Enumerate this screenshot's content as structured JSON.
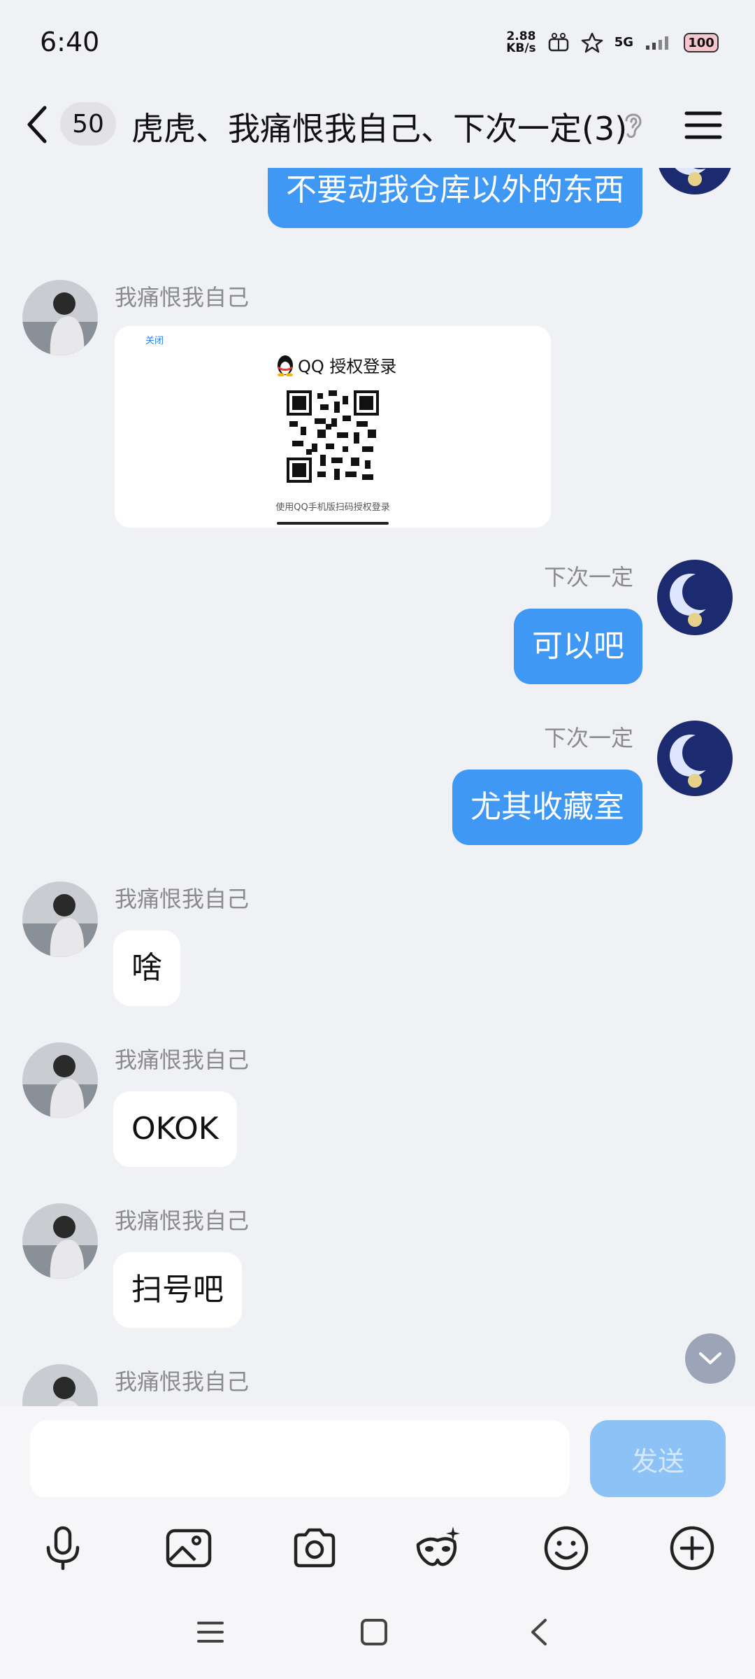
{
  "status_bar": {
    "time": "6:40",
    "speed_value": "2.88",
    "speed_unit": "KB/s",
    "network": "5G",
    "battery": "100"
  },
  "header": {
    "unread_count": "50",
    "title": "虎虎、我痛恨我自己、下次一定(3)"
  },
  "messages": [
    {
      "side": "right",
      "text": "不要动我仓库以外的东西"
    },
    {
      "side": "left",
      "sender": "我痛恨我自己",
      "card": {
        "close_label": "关闭",
        "title": "QQ 授权登录",
        "caption": "使用QQ手机版扫码授权登录"
      }
    },
    {
      "side": "right",
      "sender": "下次一定",
      "text": "可以吧"
    },
    {
      "side": "right",
      "sender": "下次一定",
      "text": "尤其收藏室"
    },
    {
      "side": "left",
      "sender": "我痛恨我自己",
      "text": "啥"
    },
    {
      "side": "left",
      "sender": "我痛恨我自己",
      "text": "OKOK"
    },
    {
      "side": "left",
      "sender": "我痛恨我自己",
      "text": "扫号吧"
    },
    {
      "side": "left",
      "sender": "我痛恨我自己"
    }
  ],
  "composer": {
    "input_value": "",
    "send_label": "发送"
  },
  "toolbar_icons": [
    "microphone-icon",
    "image-icon",
    "camera-icon",
    "mask-icon",
    "emoji-icon",
    "plus-icon"
  ],
  "colors": {
    "my_bubble": "#3f98f4",
    "send_button": "#8cc2f6",
    "background": "#f0f1f5"
  }
}
